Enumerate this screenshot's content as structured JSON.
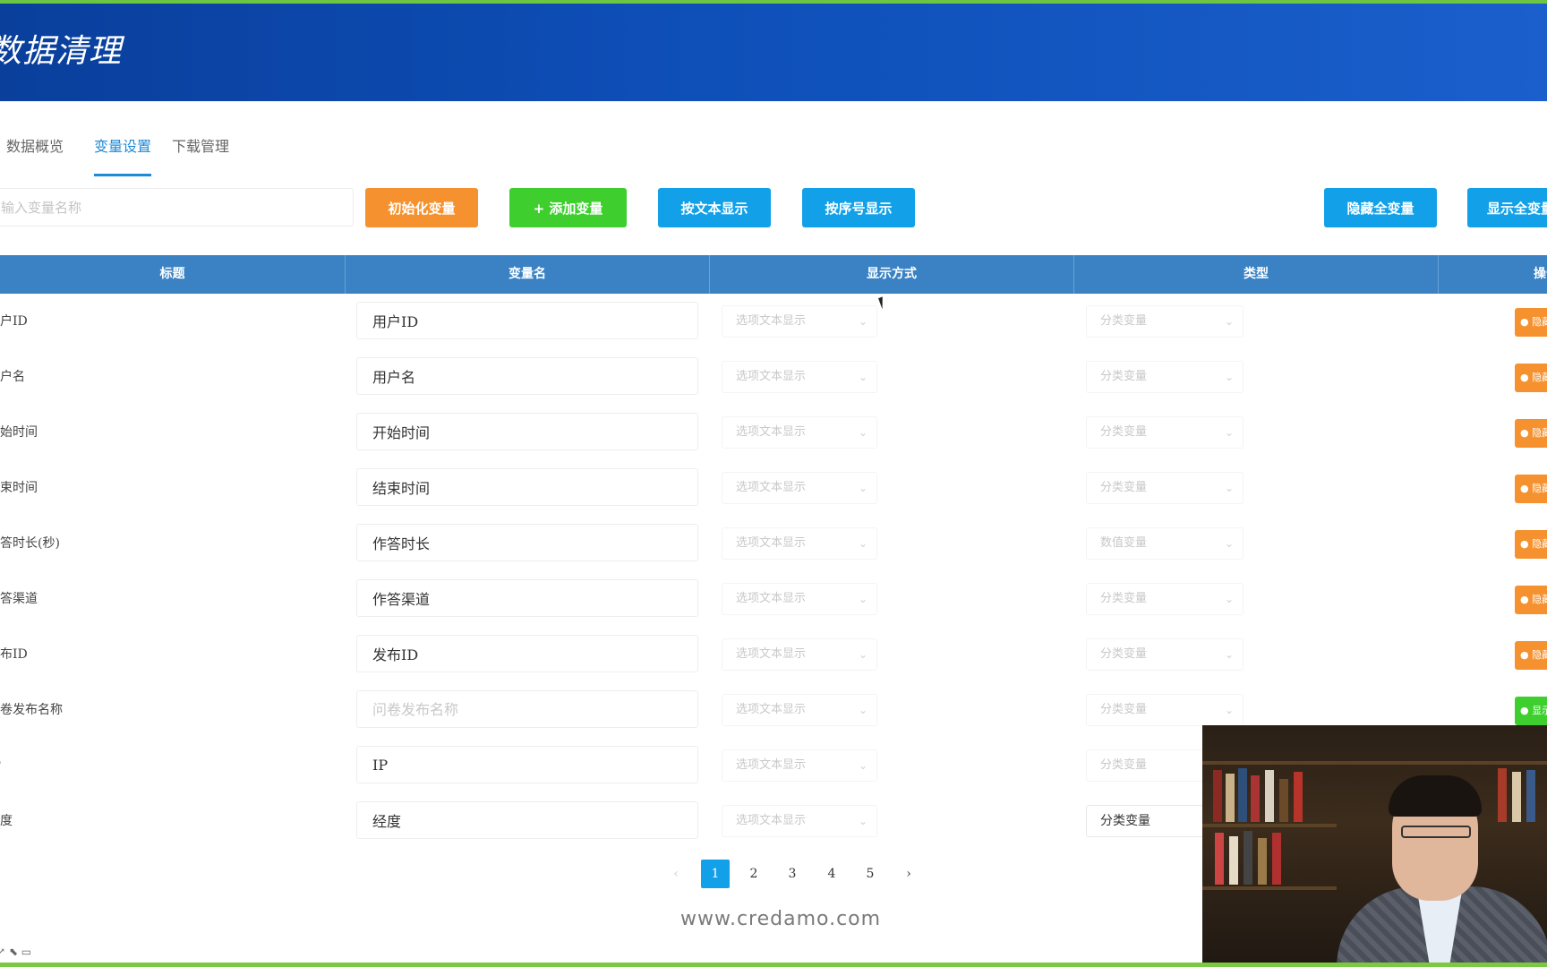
{
  "header": {
    "title": "数据清理"
  },
  "tabs": [
    {
      "label": "数据概览"
    },
    {
      "label": "变量设置"
    },
    {
      "label": "下载管理"
    }
  ],
  "toolbar": {
    "search_placeholder": "输入变量名称",
    "init_label": "初始化变量",
    "add_label": "+ 添加变量",
    "text_display_label": "按文本显示",
    "seq_display_label": "按序号显示",
    "hide_all_label": "隐藏全变量",
    "show_all_label": "显示全变量"
  },
  "table": {
    "headers": [
      "标题",
      "变量名",
      "显示方式",
      "类型",
      "操作"
    ],
    "rows": [
      {
        "title": "用户ID",
        "var_name": "用户ID",
        "var_placeholder": "",
        "display": "选项文本显示",
        "type": "分类变量",
        "op": "隐藏",
        "op_color": "#f5922f"
      },
      {
        "title": "用户名",
        "var_name": "用户名",
        "var_placeholder": "",
        "display": "选项文本显示",
        "type": "分类变量",
        "op": "隐藏",
        "op_color": "#f5922f"
      },
      {
        "title": "开始时间",
        "var_name": "开始时间",
        "var_placeholder": "",
        "display": "选项文本显示",
        "type": "分类变量",
        "op": "隐藏",
        "op_color": "#f5922f"
      },
      {
        "title": "结束时间",
        "var_name": "结束时间",
        "var_placeholder": "",
        "display": "选项文本显示",
        "type": "分类变量",
        "op": "隐藏",
        "op_color": "#f5922f"
      },
      {
        "title": "作答时长(秒)",
        "var_name": "作答时长",
        "var_placeholder": "",
        "display": "选项文本显示",
        "type": "数值变量",
        "op": "隐藏",
        "op_color": "#f5922f"
      },
      {
        "title": "作答渠道",
        "var_name": "作答渠道",
        "var_placeholder": "",
        "display": "选项文本显示",
        "type": "分类变量",
        "op": "隐藏",
        "op_color": "#f5922f"
      },
      {
        "title": "发布ID",
        "var_name": "发布ID",
        "var_placeholder": "",
        "display": "选项文本显示",
        "type": "分类变量",
        "op": "隐藏",
        "op_color": "#f5922f"
      },
      {
        "title": "问卷发布名称",
        "var_name": "",
        "var_placeholder": "问卷发布名称",
        "display": "选项文本显示",
        "type": "分类变量",
        "op": "显示",
        "op_color": "#3ecf2f"
      },
      {
        "title": "IP",
        "var_name": "IP",
        "var_placeholder": "",
        "display": "选项文本显示",
        "type": "分类变量",
        "op": "",
        "op_color": ""
      },
      {
        "title": "经度",
        "var_name": "经度",
        "var_placeholder": "",
        "display": "选项文本显示",
        "type": "分类变量",
        "op": "",
        "op_color": ""
      }
    ]
  },
  "pagination": {
    "prev": "‹",
    "next": "›",
    "pages": [
      "1",
      "2",
      "3",
      "4",
      "5"
    ],
    "current": "1"
  },
  "watermark": "www.credamo.com",
  "colors": {
    "header": "#0e4fb8",
    "accent": "#1f8ad8",
    "table_header": "#3a82c4",
    "orange": "#f5922f",
    "green": "#3ecf2f",
    "blue": "#12a0e8"
  }
}
